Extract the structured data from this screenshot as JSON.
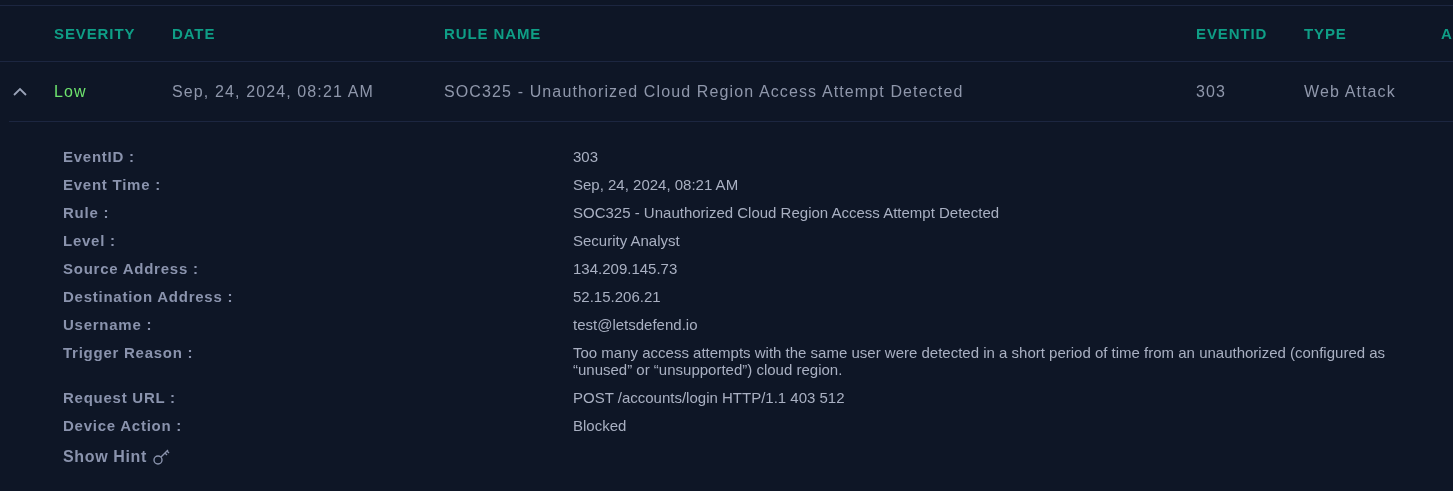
{
  "table": {
    "columns": [
      "SEVERITY",
      "DATE",
      "RULE NAME",
      "EVENTID",
      "TYPE",
      "A"
    ],
    "rows": [
      {
        "expanded": true,
        "color": "#6ee36e",
        "cells": [
          "Low",
          "Sep, 24, 2024, 08:21 AM",
          "SOC325 - Unauthorized Cloud Region Access Attempt Detected",
          "303",
          "Web Attack"
        ],
        "details": [
          {
            "label": "EventID :",
            "value": "303"
          },
          {
            "label": "Event Time :",
            "value": "Sep, 24, 2024, 08:21 AM"
          },
          {
            "label": "Rule :",
            "value": "SOC325 - Unauthorized Cloud Region Access Attempt Detected"
          },
          {
            "label": "Level :",
            "value": "Security Analyst"
          },
          {
            "label": "Source Address :",
            "value": "134.209.145.73"
          },
          {
            "label": "Destination Address :",
            "value": "52.15.206.21"
          },
          {
            "label": "Username :",
            "value": "test@letsdefend.io"
          },
          {
            "label": "Trigger Reason :",
            "value": "Too many access attempts with the same user were detected in a short period of time from an unauthorized (configured as “unused” or “unsupported”) cloud region."
          },
          {
            "label": "Request URL :",
            "value": "POST /accounts/login HTTP/1.1 403 512"
          },
          {
            "label": "Device Action :",
            "value": "Blocked"
          }
        ],
        "hint": {
          "label": "Show Hint"
        }
      }
    ]
  }
}
